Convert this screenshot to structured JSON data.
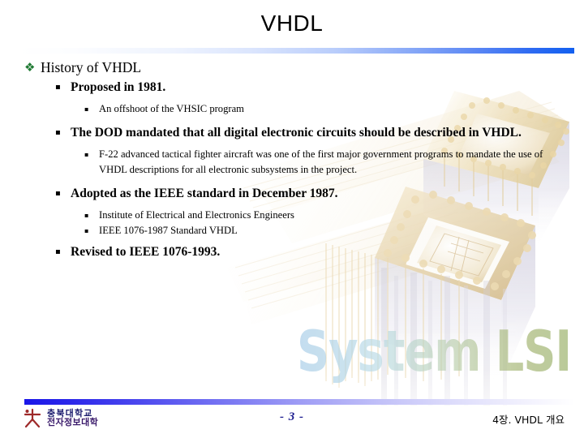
{
  "slide": {
    "title": "VHDL",
    "bullet_glyphs": {
      "level1": "❖",
      "level2": "▪",
      "level3": "▪"
    },
    "outline": [
      {
        "level": 1,
        "text": "History of VHDL"
      },
      {
        "level": 2,
        "text": "Proposed in 1981."
      },
      {
        "level": 3,
        "text": "An offshoot of the VHSIC program"
      },
      {
        "level": 2,
        "text": "The DOD mandated that all digital electronic circuits should be described in VHDL."
      },
      {
        "level": 3,
        "text": "F-22 advanced tactical fighter aircraft was one of the first major government programs to mandate the use of VHDL descriptions for all electronic subsystems in the project."
      },
      {
        "level": 2,
        "text": "Adopted as the IEEE standard in December 1987."
      },
      {
        "level": 3,
        "text": "Institute of Electrical and Electronics Engineers"
      },
      {
        "level": 3,
        "text": "IEEE 1076-1987 Standard VHDL"
      },
      {
        "level": 2,
        "text": "Revised to IEEE 1076-1993."
      }
    ]
  },
  "background": {
    "watermark_text": "System LSI",
    "artwork_description": "faded IC chip packages with gold pins"
  },
  "footer": {
    "university_line1": "충북대학교",
    "university_line2": "전자정보대학",
    "page_number": "- 3 -",
    "chapter_label": "4장. VHDL 개요"
  },
  "colors": {
    "header_rule_end": "#1260f0",
    "footer_rule_start": "#1a16e8",
    "level1_bullet": "#1f7a33",
    "page_number": "#1b1b8f",
    "logo_mark": "#9e2a2a",
    "watermark_blue": "#b7d3ea",
    "watermark_green": "#9fb277",
    "chip_gold": "#e8d7a8"
  }
}
